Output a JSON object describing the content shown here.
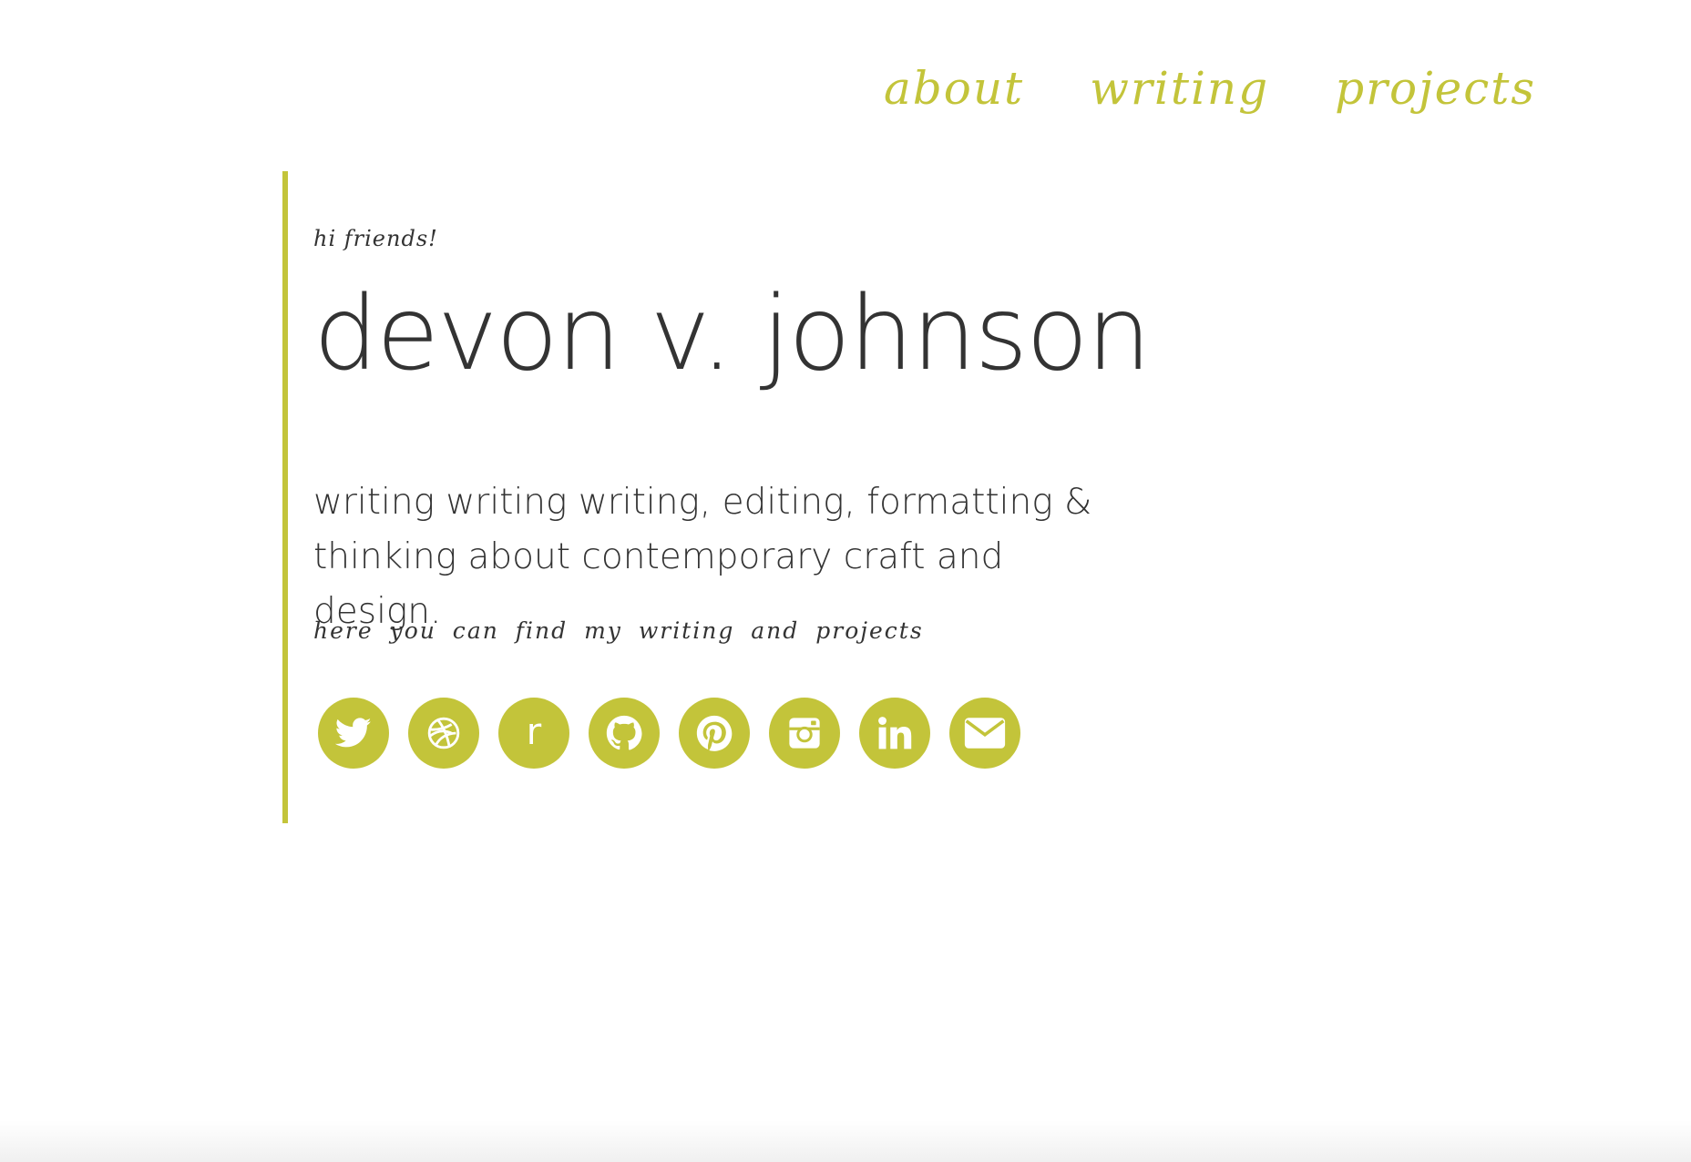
{
  "nav": {
    "items": [
      {
        "label": "about"
      },
      {
        "label": "writing"
      },
      {
        "label": "projects"
      }
    ]
  },
  "intro": {
    "greeting": "hi friends!",
    "name": "devon v. johnson",
    "tagline_line1": "writing writing writing, editing, formatting &",
    "tagline_line2": "thinking about contemporary craft and design.",
    "subtitle": "here you can find my writing and projects"
  },
  "social": {
    "icons": [
      "twitter-icon",
      "dribbble-icon",
      "r-icon",
      "github-icon",
      "pinterest-icon",
      "instagram-icon",
      "linkedin-icon",
      "email-icon"
    ],
    "r_glyph": "r"
  },
  "colors": {
    "accent": "#c3c43a",
    "text": "#333333",
    "background": "#ffffff"
  }
}
